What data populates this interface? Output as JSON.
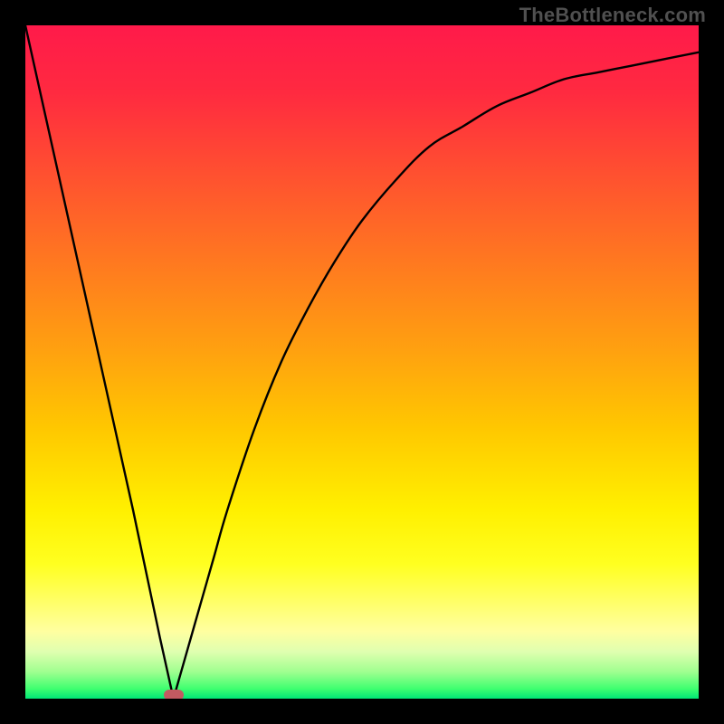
{
  "watermark": "TheBottleneck.com",
  "colors": {
    "frame": "#000000",
    "curve": "#000000",
    "marker": "#c25a61",
    "gradient_stops": [
      {
        "offset": 0.0,
        "color": "#ff1a4a"
      },
      {
        "offset": 0.1,
        "color": "#ff2a40"
      },
      {
        "offset": 0.22,
        "color": "#ff5030"
      },
      {
        "offset": 0.35,
        "color": "#ff7820"
      },
      {
        "offset": 0.48,
        "color": "#ffa010"
      },
      {
        "offset": 0.6,
        "color": "#ffc800"
      },
      {
        "offset": 0.72,
        "color": "#fff000"
      },
      {
        "offset": 0.8,
        "color": "#ffff20"
      },
      {
        "offset": 0.85,
        "color": "#ffff60"
      },
      {
        "offset": 0.9,
        "color": "#ffffa0"
      },
      {
        "offset": 0.93,
        "color": "#e0ffb0"
      },
      {
        "offset": 0.96,
        "color": "#a0ff90"
      },
      {
        "offset": 0.985,
        "color": "#40ff70"
      },
      {
        "offset": 1.0,
        "color": "#00e676"
      }
    ]
  },
  "chart_data": {
    "type": "line",
    "title": "",
    "xlabel": "",
    "ylabel": "",
    "xlim": [
      0,
      1
    ],
    "ylim": [
      0,
      1
    ],
    "grid": false,
    "legend": false,
    "note": "V-shaped bottleneck curve. y represents bottleneck severity (1 = worst / red top, 0 = best / green bottom). Minimum near x ≈ 0.22.",
    "x": [
      0.0,
      0.04,
      0.08,
      0.12,
      0.16,
      0.2,
      0.22,
      0.24,
      0.26,
      0.28,
      0.3,
      0.34,
      0.38,
      0.42,
      0.46,
      0.5,
      0.55,
      0.6,
      0.65,
      0.7,
      0.75,
      0.8,
      0.85,
      0.9,
      0.95,
      1.0
    ],
    "values": [
      1.0,
      0.82,
      0.64,
      0.46,
      0.28,
      0.09,
      0.0,
      0.07,
      0.14,
      0.21,
      0.28,
      0.4,
      0.5,
      0.58,
      0.65,
      0.71,
      0.77,
      0.82,
      0.85,
      0.88,
      0.9,
      0.92,
      0.93,
      0.94,
      0.95,
      0.96
    ],
    "min_point": {
      "x": 0.22,
      "y": 0.0
    }
  },
  "marker": {
    "x_frac": 0.22,
    "y_frac": 0.995
  }
}
